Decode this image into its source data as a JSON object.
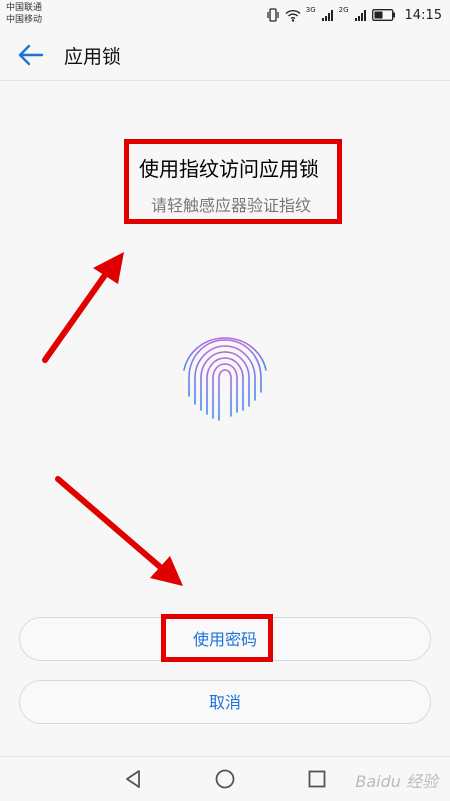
{
  "status_bar": {
    "carrier_1": "中国联通",
    "carrier_2": "中国移动",
    "network_1": "3G",
    "network_2": "2G",
    "time": "14:15",
    "icons": [
      "vibrate-icon",
      "wifi-icon",
      "signal-icon",
      "battery-icon"
    ]
  },
  "app_bar": {
    "title": "应用锁",
    "back_icon": "back-arrow-icon"
  },
  "content": {
    "title": "使用指纹访问应用锁",
    "subtitle": "请轻触感应器验证指纹",
    "fingerprint_icon": "fingerprint-icon"
  },
  "buttons": {
    "use_password": "使用密码",
    "cancel": "取消"
  },
  "nav_bar": {
    "icons": [
      "back-triangle-icon",
      "home-circle-icon",
      "recents-square-icon"
    ]
  },
  "watermark": "Baidu 经验",
  "colors": {
    "accent": "#1d72d8",
    "annotation": "#e00000"
  }
}
